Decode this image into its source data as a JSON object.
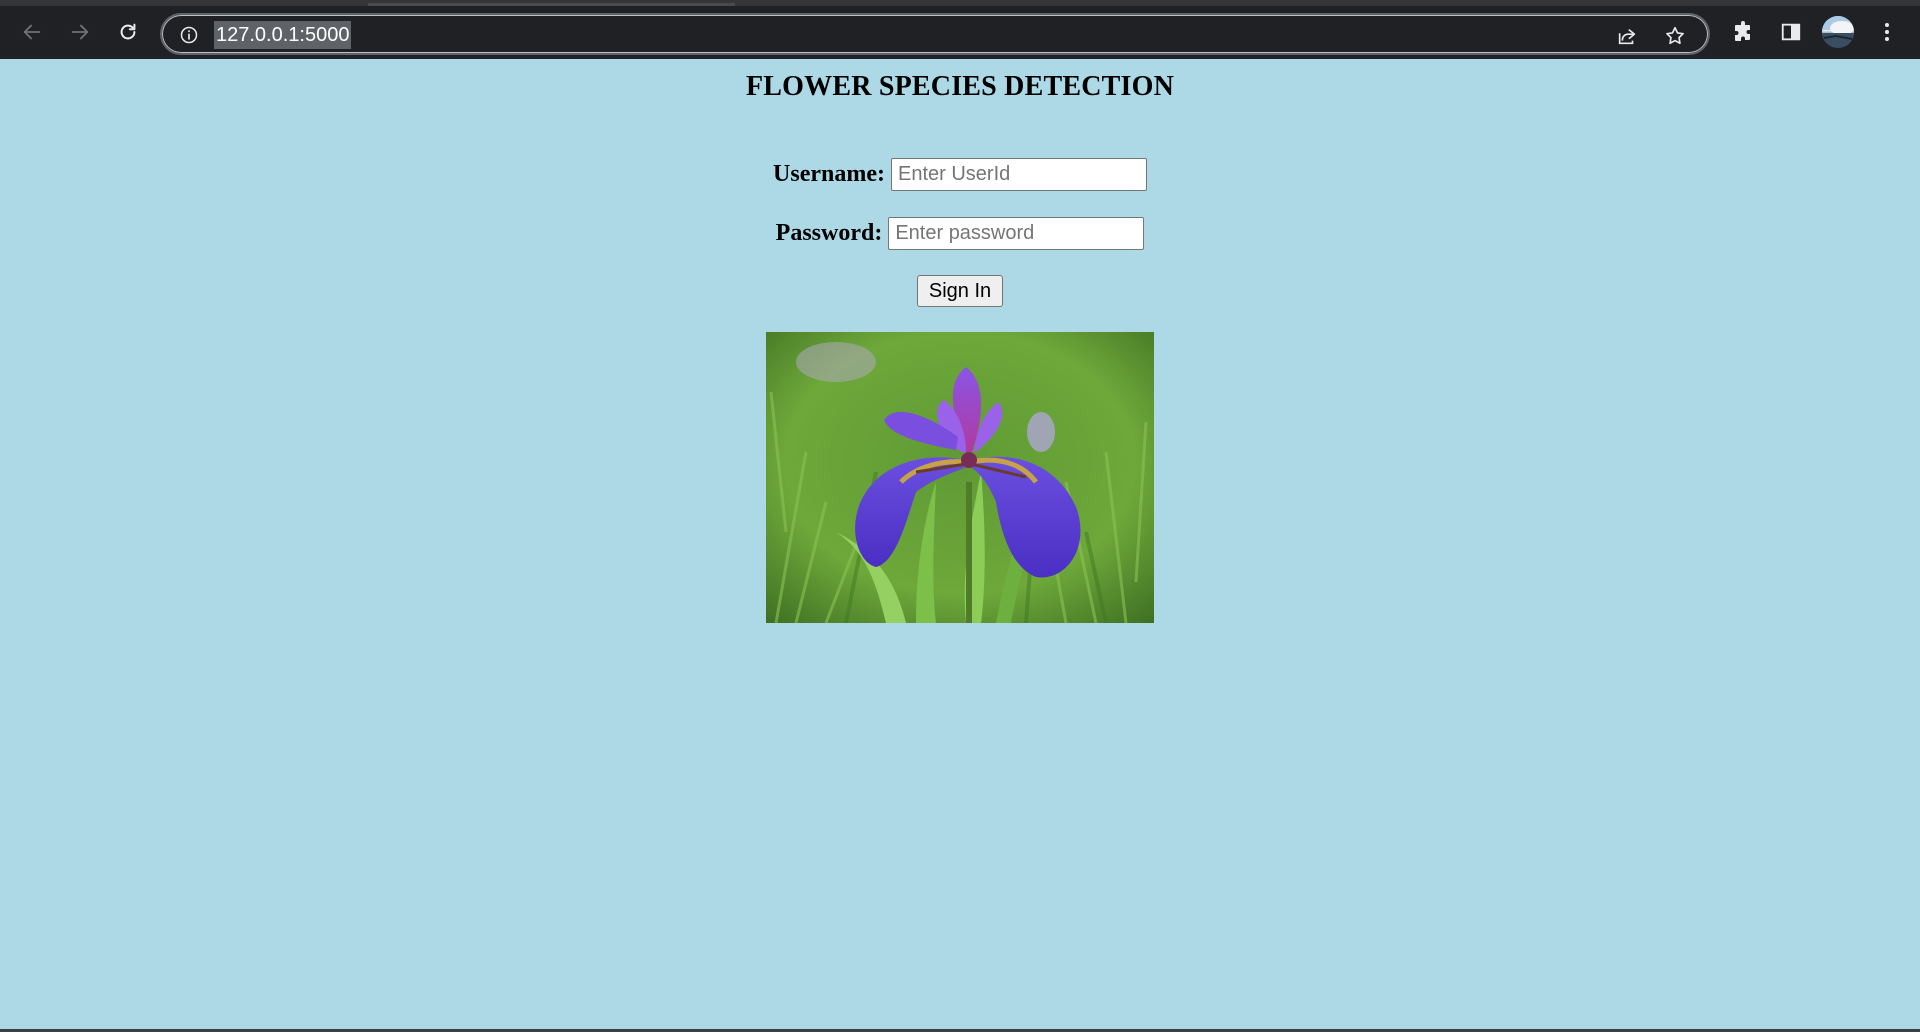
{
  "browser": {
    "url": "127.0.0.1:5000",
    "icons": {
      "back": "arrow-left-icon",
      "forward": "arrow-right-icon",
      "reload": "reload-icon",
      "site_info": "info-icon",
      "share": "share-icon",
      "bookmark": "star-icon",
      "extensions": "puzzle-icon",
      "side_panel": "side-panel-icon",
      "profile": "avatar",
      "menu": "kebab-menu-icon"
    }
  },
  "page": {
    "title": "FLOWER SPECIES DETECTION",
    "username_label": "Username:",
    "username_placeholder": "Enter UserId",
    "password_label": "Password:",
    "password_placeholder": "Enter password",
    "signin_label": "Sign In",
    "image": "iris-flower-photo"
  },
  "colors": {
    "background": "#add8e6",
    "toolbar": "#202124"
  }
}
